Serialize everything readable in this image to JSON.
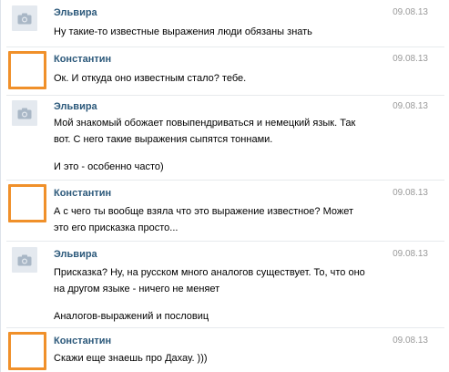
{
  "messages": [
    {
      "author": "Эльвира",
      "date": "09.08.13",
      "avatar": "camera-placeholder",
      "lines": [
        "Ну такие-то известные выражения люди обязаны знать"
      ]
    },
    {
      "author": "Константин",
      "date": "09.08.13",
      "avatar": "orange-frame",
      "lines": [
        "Ок. И откуда оно известным стало? тебе."
      ]
    },
    {
      "author": "Эльвира",
      "date": "09.08.13",
      "avatar": "camera-placeholder",
      "lines": [
        "Мой знакомый обожает повыпендриваться и немецкий язык. Так",
        "вот. С него такие выражения сыпятся тоннами."
      ],
      "followup": "И это - особенно часто)"
    },
    {
      "author": "Константин",
      "date": "09.08.13",
      "avatar": "orange-frame",
      "lines": [
        "А с чего ты вообще взяла что это выражение известное? Может",
        "это его присказка просто..."
      ]
    },
    {
      "author": "Эльвира",
      "date": "09.08.13",
      "avatar": "camera-placeholder",
      "lines": [
        "Присказка? Ну, на русском много аналогов существует. То, что оно",
        "на другом языке - ничего не меняет"
      ],
      "followup": "Аналогов-выражений и пословиц"
    },
    {
      "author": "Константин",
      "date": "09.08.13",
      "avatar": "orange-frame",
      "lines": [
        "Скажи еще знаешь про Дахау. )))"
      ]
    }
  ],
  "colors": {
    "author": "#2b587a",
    "date": "#999999",
    "avatar_frame": "#f0902a",
    "avatar_placeholder": "#e4e9ef"
  }
}
